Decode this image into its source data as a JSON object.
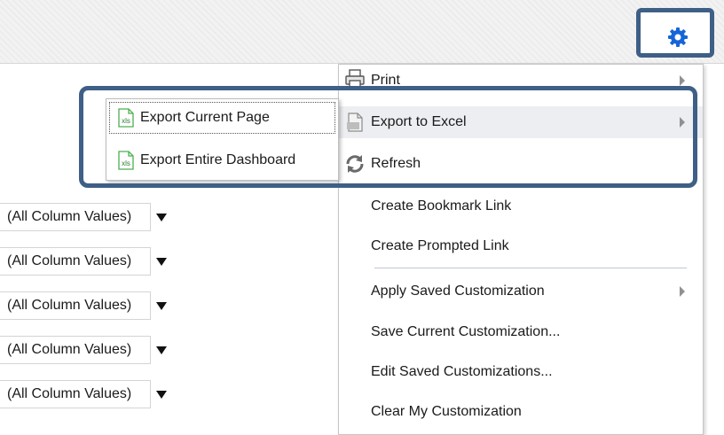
{
  "menu": {
    "items": [
      {
        "label": "Print",
        "icon": "printer-icon",
        "has_submenu": true
      },
      {
        "label": "Export to Excel",
        "icon": "excel-export-icon",
        "has_submenu": true,
        "highlighted": true
      },
      {
        "label": "Refresh",
        "icon": "refresh-icon",
        "has_submenu": false
      },
      {
        "label": "Create Bookmark Link",
        "has_submenu": false
      },
      {
        "label": "Create Prompted Link",
        "has_submenu": false
      },
      {
        "label": "Apply Saved Customization",
        "has_submenu": true
      },
      {
        "label": "Save Current Customization...",
        "has_submenu": false
      },
      {
        "label": "Edit Saved Customizations...",
        "has_submenu": false
      },
      {
        "label": "Clear My Customization",
        "has_submenu": false
      }
    ]
  },
  "submenu": {
    "items": [
      {
        "label": "Export Current Page",
        "icon": "xls-file-icon"
      },
      {
        "label": "Export Entire Dashboard",
        "icon": "xls-file-icon"
      }
    ],
    "icon_text": "xls"
  },
  "prompts": {
    "values": [
      "(All Column Values)",
      "(All Column Values)",
      "(All Column Values)",
      "(All Column Values)",
      "(All Column Values)"
    ]
  },
  "colors": {
    "gear": "#1565d8",
    "annotation": "#3e5f86",
    "excel_green": "#4caf50"
  }
}
